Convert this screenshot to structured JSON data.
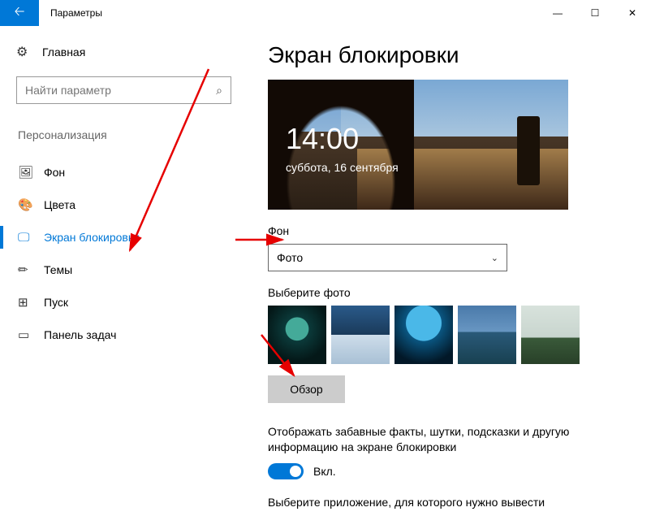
{
  "window": {
    "title": "Параметры"
  },
  "sidebar": {
    "home": "Главная",
    "search_placeholder": "Найти параметр",
    "section": "Персонализация",
    "items": [
      {
        "icon": "🖼",
        "label": "Фон"
      },
      {
        "icon": "🎨",
        "label": "Цвета"
      },
      {
        "icon": "🖵",
        "label": "Экран блокировки",
        "active": true
      },
      {
        "icon": "✏",
        "label": "Темы"
      },
      {
        "icon": "⊞",
        "label": "Пуск"
      },
      {
        "icon": "▭",
        "label": "Панель задач"
      }
    ]
  },
  "main": {
    "title": "Экран блокировки",
    "preview": {
      "time": "14:00",
      "date": "суббота, 16 сентября"
    },
    "background_label": "Фон",
    "background_value": "Фото",
    "choose_label": "Выберите фото",
    "browse": "Обзор",
    "facts_desc": "Отображать забавные факты, шутки, подсказки и другую информацию на экране блокировки",
    "toggle_label": "Вкл.",
    "app_desc": "Выберите приложение, для которого нужно вывести"
  }
}
